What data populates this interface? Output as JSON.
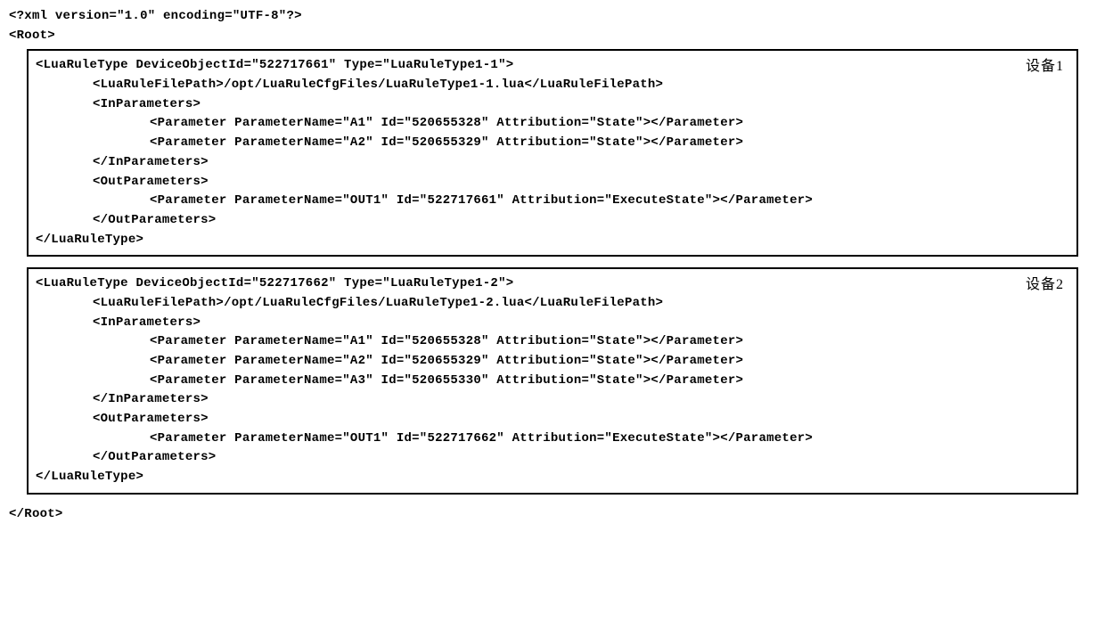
{
  "xml_header": "<?xml version=\"1.0\" encoding=\"UTF-8\"?>",
  "root_open": "<Root>",
  "root_close": "</Root>",
  "devices": [
    {
      "label": "设备1",
      "open_tag": "<LuaRuleType DeviceObjectId=\"522717661\" Type=\"LuaRuleType1-1\">",
      "filepath_open": "<LuaRuleFilePath>",
      "filepath_value": "/opt/LuaRuleCfgFiles/LuaRuleType1-1.lua",
      "filepath_close": "</LuaRuleFilePath>",
      "inparams_open": "<InParameters>",
      "inparams_close": "</InParameters>",
      "in_params": [
        "<Parameter ParameterName=\"A1\" Id=\"520655328\" Attribution=\"State\"></Parameter>",
        "<Parameter ParameterName=\"A2\" Id=\"520655329\" Attribution=\"State\"></Parameter>"
      ],
      "outparams_open": "<OutParameters>",
      "outparams_close": "</OutParameters>",
      "out_params": [
        "<Parameter ParameterName=\"OUT1\" Id=\"522717661\" Attribution=\"ExecuteState\"></Parameter>"
      ],
      "close_tag": "</LuaRuleType>"
    },
    {
      "label": "设备2",
      "open_tag": "<LuaRuleType DeviceObjectId=\"522717662\" Type=\"LuaRuleType1-2\">",
      "filepath_open": "<LuaRuleFilePath>",
      "filepath_value": "/opt/LuaRuleCfgFiles/LuaRuleType1-2.lua",
      "filepath_close": "</LuaRuleFilePath>",
      "inparams_open": "<InParameters>",
      "inparams_close": "</InParameters>",
      "in_params": [
        "<Parameter ParameterName=\"A1\" Id=\"520655328\" Attribution=\"State\"></Parameter>",
        "<Parameter ParameterName=\"A2\" Id=\"520655329\" Attribution=\"State\"></Parameter>",
        "<Parameter ParameterName=\"A3\" Id=\"520655330\" Attribution=\"State\"></Parameter>"
      ],
      "outparams_open": "<OutParameters>",
      "outparams_close": "</OutParameters>",
      "out_params": [
        "<Parameter ParameterName=\"OUT1\" Id=\"522717662\" Attribution=\"ExecuteState\"></Parameter>"
      ],
      "close_tag": "</LuaRuleType>"
    }
  ]
}
